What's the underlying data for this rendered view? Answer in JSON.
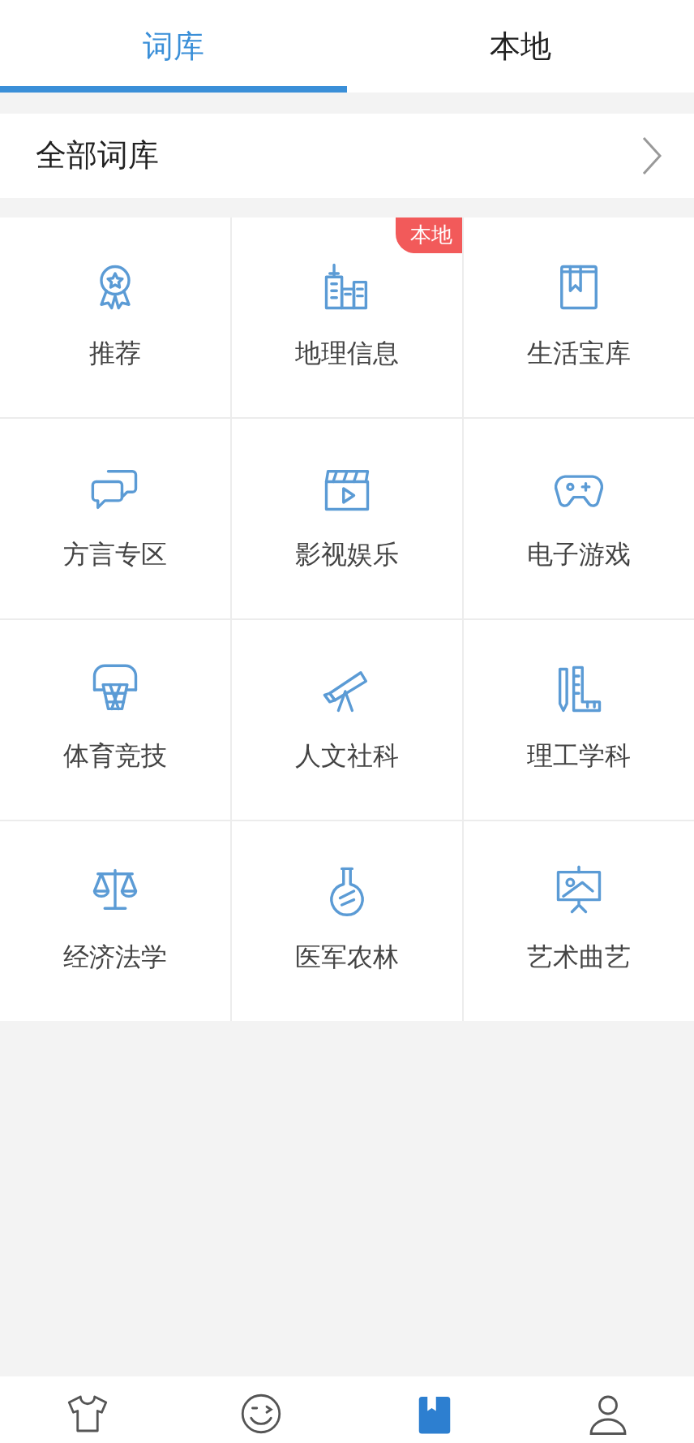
{
  "tabs": [
    {
      "label": "词库",
      "selected": true
    },
    {
      "label": "本地",
      "selected": false
    }
  ],
  "all_row": {
    "label": "全部词库"
  },
  "categories": [
    {
      "label": "推荐"
    },
    {
      "label": "地理信息",
      "badge": "本地"
    },
    {
      "label": "生活宝库"
    },
    {
      "label": "方言专区"
    },
    {
      "label": "影视娱乐"
    },
    {
      "label": "电子游戏"
    },
    {
      "label": "体育竞技"
    },
    {
      "label": "人文社科"
    },
    {
      "label": "理工学科"
    },
    {
      "label": "经济法学"
    },
    {
      "label": "医军农林"
    },
    {
      "label": "艺术曲艺"
    }
  ],
  "bottom_nav": [
    {
      "selected": false
    },
    {
      "selected": false
    },
    {
      "selected": true
    },
    {
      "selected": false
    }
  ]
}
